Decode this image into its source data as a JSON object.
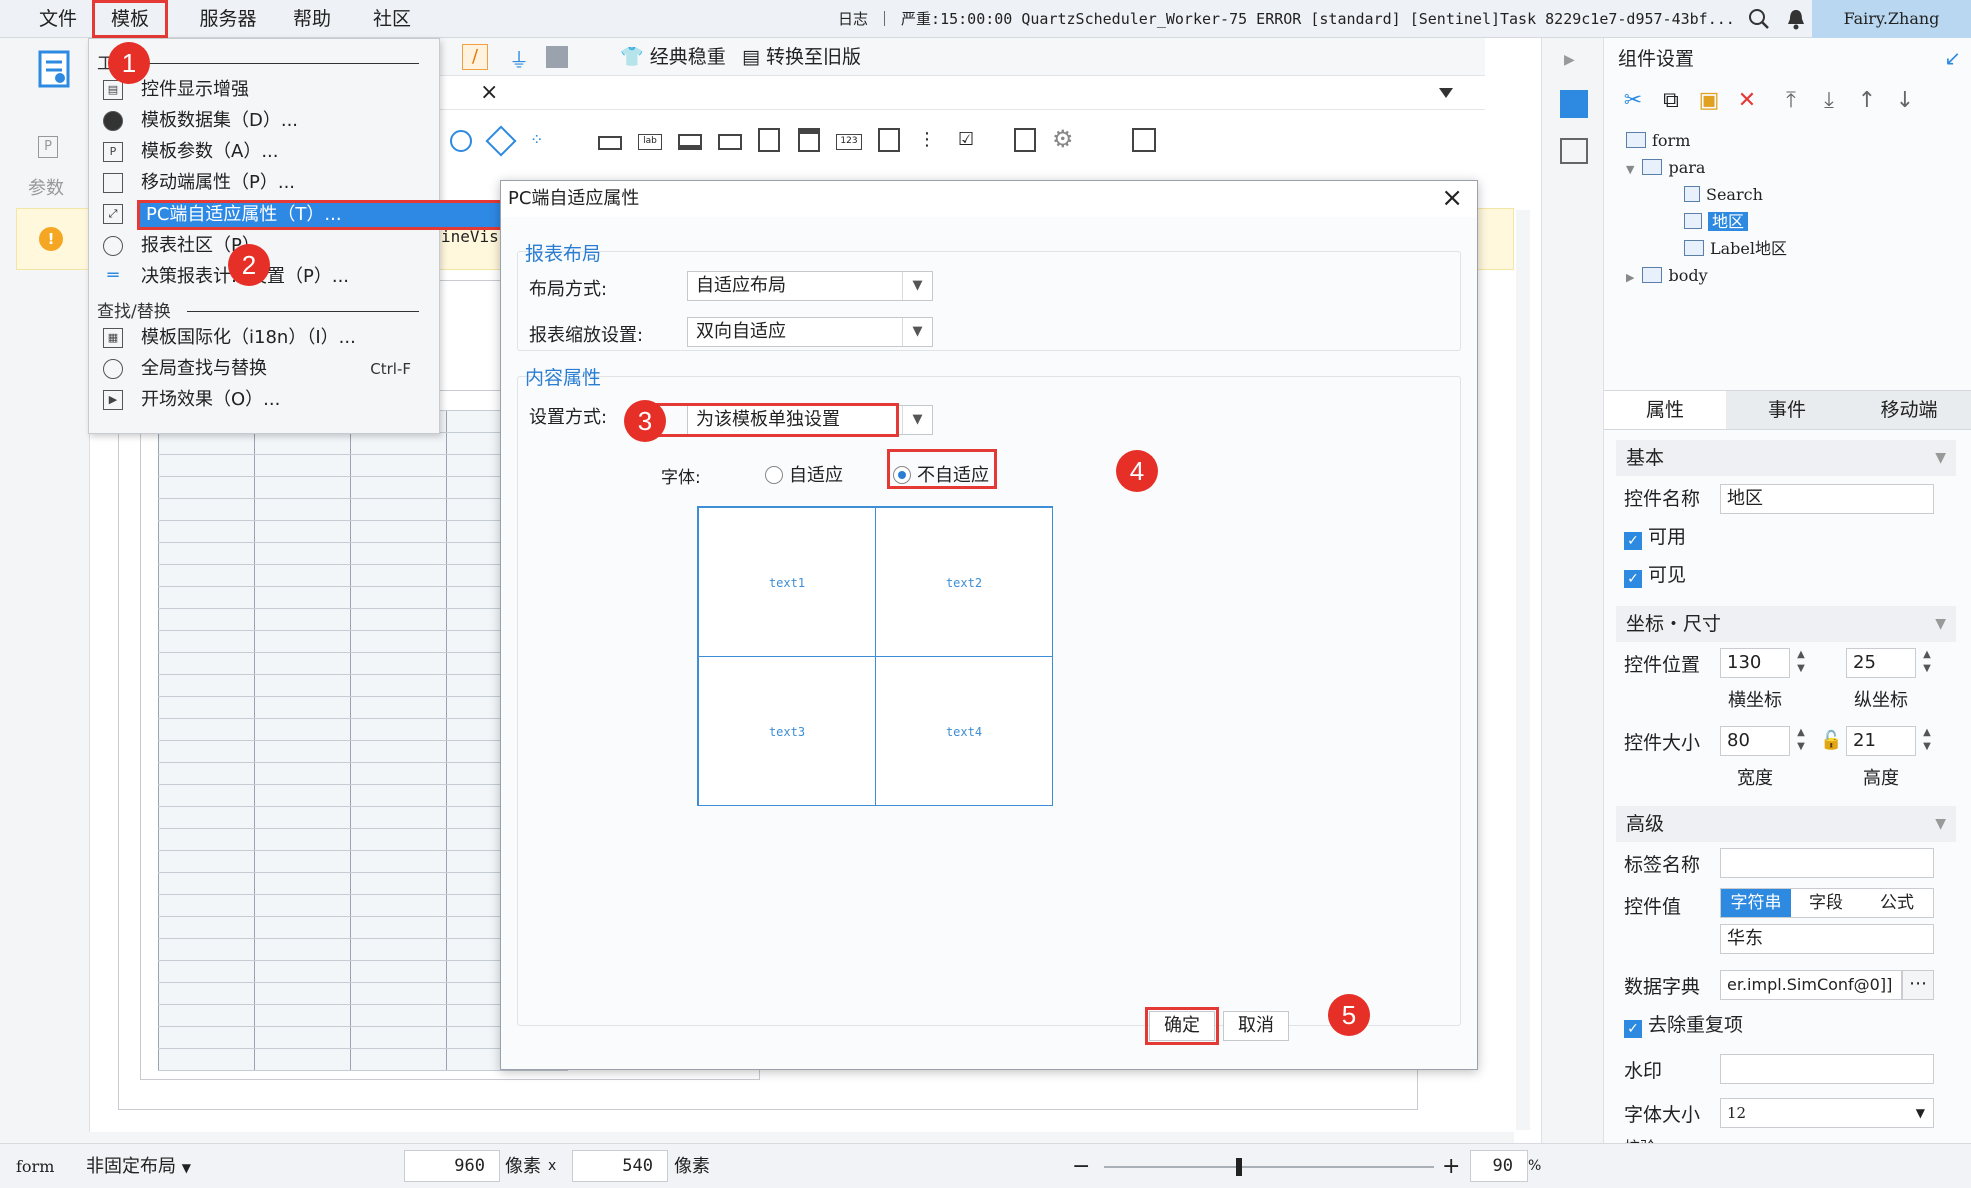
{
  "menubar": {
    "items": [
      "文件",
      "模板",
      "服务器",
      "帮助",
      "社区"
    ],
    "status_text": "日志 ｜ 严重:15:00:00 QuartzScheduler_Worker-75 ERROR [standard] [Sentinel]Task 8229c1e7-d957-43bf...",
    "user": "Fairy.Zhang"
  },
  "left_strip": {
    "param_label": "参数"
  },
  "toolbar": {
    "classic_label": "经典稳重",
    "convert_label": "转换至旧版"
  },
  "warning": {
    "text": "ineVis,"
  },
  "dropdown": {
    "group1_label": "工",
    "items": [
      {
        "label": "控件显示增强",
        "icon": "widget-icon"
      },
      {
        "label": "模板数据集（D）...",
        "icon": "database-icon"
      },
      {
        "label": "模板参数（A）...",
        "icon": "param-icon"
      },
      {
        "label": "移动端属性（P）...",
        "icon": "mobile-icon"
      },
      {
        "label": "PC端自适应属性（T）...",
        "icon": "resize-icon"
      },
      {
        "label": "报表社区（P）",
        "icon": "community-icon"
      },
      {
        "label": "决策报表计…设置（P）...",
        "icon": "lines-icon"
      }
    ],
    "group2_label": "查找/替换",
    "items2": [
      {
        "label": "模板国际化（i18n）（I）...",
        "icon": "i18n-icon"
      },
      {
        "label": "全局查找与替换",
        "shortcut": "Ctrl-F",
        "icon": "search-icon"
      },
      {
        "label": "开场效果（O）...",
        "icon": "play-icon"
      }
    ]
  },
  "dialog": {
    "title": "PC端自适应属性",
    "section1": "报表布局",
    "layout_label": "布局方式:",
    "layout_value": "自适应布局",
    "zoom_label": "报表缩放设置:",
    "zoom_value": "双向自适应",
    "section2": "内容属性",
    "set_label": "设置方式:",
    "set_value": "为该模板单独设置",
    "font_label": "字体:",
    "radio_adaptive": "自适应",
    "radio_fixed": "不自适应",
    "preview": [
      "text1",
      "text2",
      "text3",
      "text4"
    ],
    "ok": "确定",
    "cancel": "取消"
  },
  "badges": [
    "1",
    "2",
    "3",
    "4",
    "5"
  ],
  "right_panel": {
    "title": "组件设置",
    "tree": [
      {
        "label": "form"
      },
      {
        "label": "para"
      },
      {
        "label": "Search"
      },
      {
        "label": "地区"
      },
      {
        "label": "Label地区"
      },
      {
        "label": "body"
      }
    ],
    "tabs": [
      "属性",
      "事件",
      "移动端"
    ],
    "sec_basic": "基本",
    "name_label": "控件名称",
    "name_value": "地区",
    "enabled": "可用",
    "visible": "可见",
    "sec_pos": "坐标・尺寸",
    "pos_label": "控件位置",
    "pos_x": "130",
    "pos_y": "25",
    "x_label": "横坐标",
    "y_label": "纵坐标",
    "size_label": "控件大小",
    "width": "80",
    "height": "21",
    "w_label": "宽度",
    "h_label": "高度",
    "sec_adv": "高级",
    "tag_label": "标签名称",
    "value_label": "控件值",
    "value_tabs": [
      "字符串",
      "字段",
      "公式"
    ],
    "value": "华东",
    "dict_label": "数据字典",
    "dict_value": "er.impl.SimConf@0]]",
    "dedupe": "去除重复项",
    "watermark_label": "水印",
    "fontsize_label": "字体大小",
    "fontsize_value": "12",
    "more_label": "校验"
  },
  "bottombar": {
    "form": "form",
    "layout": "非固定布局",
    "width": "960",
    "px1": "像素",
    "x": "x",
    "height": "540",
    "px2": "像素",
    "zoom": "90",
    "percent": "%"
  }
}
